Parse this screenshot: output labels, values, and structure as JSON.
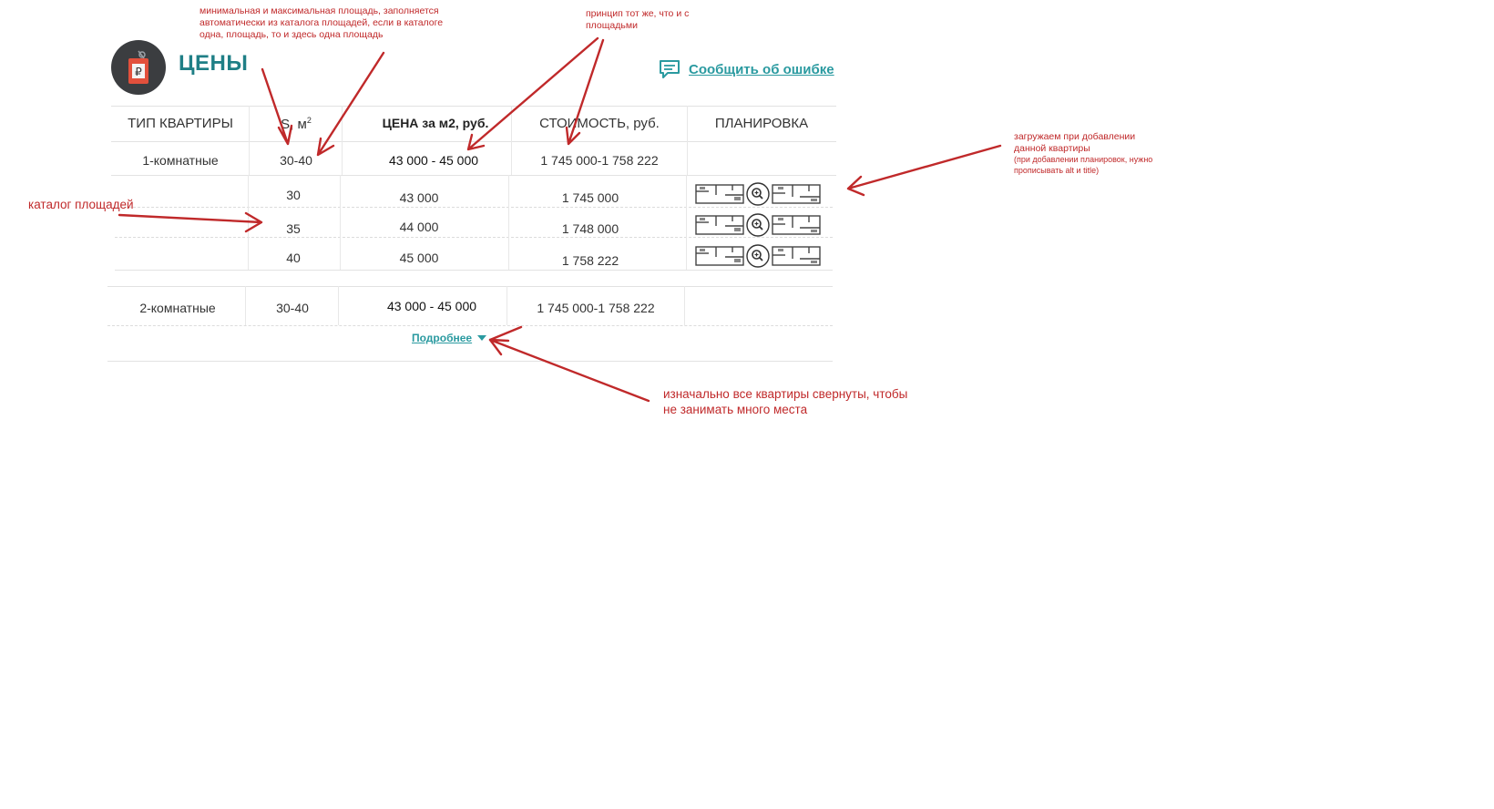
{
  "header": {
    "logo_glyph": "₽",
    "title": "ЦЕНЫ",
    "report_link": "Сообщить об ошибке",
    "report_icon": "chat-icon"
  },
  "table": {
    "columns": [
      "ТИП КВАРТИРЫ",
      "S, м",
      "ЦЕНА за м2, руб.",
      "СТОИМОСТЬ, руб.",
      "ПЛАНИРОВКА"
    ],
    "area_superscript": "2",
    "groups": [
      {
        "type": "1-комнатные",
        "area": "30-40",
        "price": "43 000 - 45 000",
        "cost": "1 745 000-1 758 222",
        "rows": [
          {
            "area": "30",
            "price": "43 000",
            "cost": "1 745 000"
          },
          {
            "area": "35",
            "price": "44 000",
            "cost": "1 748 000"
          },
          {
            "area": "40",
            "price": "45 000",
            "cost": "1 758 222"
          }
        ]
      },
      {
        "type": "2-комнатные",
        "area": "30-40",
        "price": "43 000 - 45 000",
        "cost": "1 745 000-1 758 222"
      }
    ],
    "more_label": "Подробнее"
  },
  "annotations": {
    "area_note": "минимальная и максимальная площадь, заполняется автоматически из каталога площадей, если в каталоге одна, площадь, то и здесь одна площадь",
    "price_note": "принцип тот же, что и с площадьми",
    "plan_note_1": "загружаем при добавлении",
    "plan_note_2": "данной квартиры",
    "plan_note_3": "(при добавлении планировок, нужно прописывать alt и title)",
    "catalog_note": "каталог площадей",
    "collapse_note_1": "изначально все квартиры свернуты, чтобы",
    "collapse_note_2": "не занимать много места"
  },
  "colors": {
    "accent": "#1f7f86",
    "link": "#2a9aa0",
    "annotation": "#c0292a",
    "logo_bg": "#3b3d40",
    "tag": "#e2503c"
  }
}
